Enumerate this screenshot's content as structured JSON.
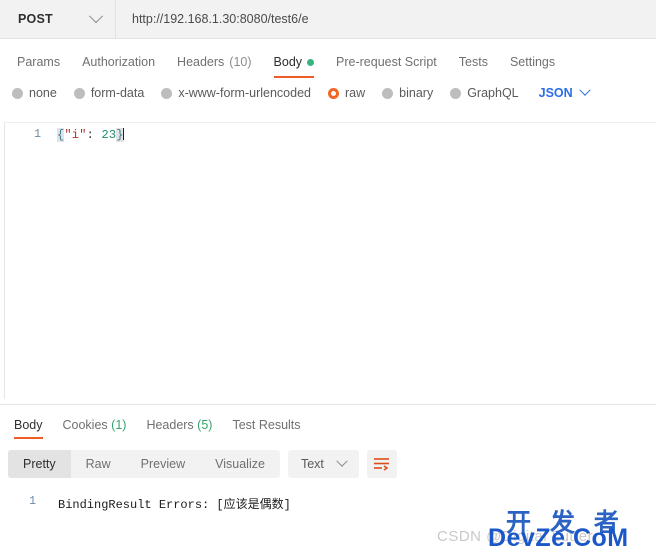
{
  "url_bar": {
    "method": "POST",
    "url": "http://192.168.1.30:8080/test6/e",
    "method_chevron_icon": "chevron-down-icon"
  },
  "request_tabs": [
    {
      "label": "Params",
      "active": false
    },
    {
      "label": "Authorization",
      "active": false
    },
    {
      "label": "Headers",
      "count": "(10)",
      "active": false
    },
    {
      "label": "Body",
      "active": true,
      "indicator": "green-dot"
    },
    {
      "label": "Pre-request Script",
      "active": false
    },
    {
      "label": "Tests",
      "active": false
    },
    {
      "label": "Settings",
      "active": false
    }
  ],
  "body_types": {
    "options": [
      {
        "label": "none",
        "selected": false
      },
      {
        "label": "form-data",
        "selected": false
      },
      {
        "label": "x-www-form-urlencoded",
        "selected": false
      },
      {
        "label": "raw",
        "selected": true
      },
      {
        "label": "binary",
        "selected": false
      },
      {
        "label": "GraphQL",
        "selected": false
      }
    ],
    "format": "JSON",
    "format_chevron_icon": "chevron-down-icon"
  },
  "request_editor": {
    "line_number": "1",
    "open_brace": "{",
    "key": "\"i\"",
    "colon": ": ",
    "value": "23",
    "close_brace": "}"
  },
  "response_tabs": [
    {
      "label": "Body",
      "active": true
    },
    {
      "label": "Cookies",
      "count": "(1)",
      "active": false
    },
    {
      "label": "Headers",
      "count": "(5)",
      "active": false
    },
    {
      "label": "Test Results",
      "active": false
    }
  ],
  "response_toolbar": {
    "views": [
      {
        "label": "Pretty",
        "active": true
      },
      {
        "label": "Raw",
        "active": false
      },
      {
        "label": "Preview",
        "active": false
      },
      {
        "label": "Visualize",
        "active": false
      }
    ],
    "format": "Text",
    "format_chevron_icon": "chevron-down-icon",
    "wrap_icon": "wrap-text-icon"
  },
  "response_body": {
    "line_number": "1",
    "text": "BindingResult Errors: [应该是偶数]"
  },
  "watermark": {
    "csdn": "CSDN @Digital Lutter",
    "cn": "开 发 者",
    "site": "DevZe.CoM"
  },
  "colors": {
    "accent": "#ef5b25",
    "raw_selected": "#f26522",
    "json_blue": "#2a6ee8",
    "green_dot": "#36b37e",
    "count_green": "#36a46b"
  }
}
